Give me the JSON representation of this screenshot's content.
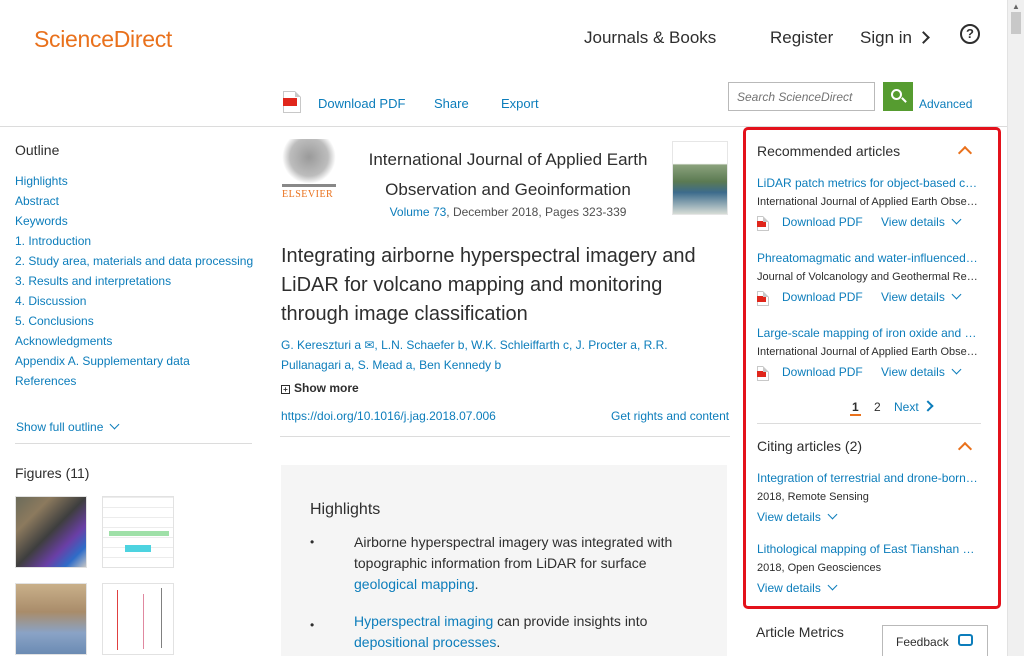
{
  "header": {
    "logo": "ScienceDirect",
    "nav": {
      "journals_books": "Journals & Books",
      "register": "Register",
      "sign_in": "Sign in",
      "help": "?"
    }
  },
  "toolbar": {
    "download_pdf": "Download PDF",
    "share": "Share",
    "export": "Export",
    "search_placeholder": "Search ScienceDirect",
    "advanced": "Advanced"
  },
  "outline": {
    "title": "Outline",
    "items": [
      "Highlights",
      "Abstract",
      "Keywords",
      "1. Introduction",
      "2. Study area, materials and data processing",
      "3. Results and interpretations",
      "4. Discussion",
      "5. Conclusions",
      "Acknowledgments",
      "Appendix A. Supplementary data",
      "References"
    ],
    "show_full": "Show full outline"
  },
  "figures": {
    "title": "Figures (11)"
  },
  "article": {
    "publisher": "ELSEVIER",
    "journal_line1": "International Journal of Applied Earth",
    "journal_line2": "Observation and Geoinformation",
    "volume_link": "Volume 73",
    "volume_rest": ", December 2018, Pages 323-339",
    "title": "Integrating airborne hyperspectral imagery and LiDAR for volcano mapping and monitoring through image classification",
    "authors_line1": "G. Kereszturi a ✉, L.N. Schaefer b, W.K. Schleiffarth c, J. Procter a, R.R.",
    "authors_line2": "Pullanagari a, S. Mead a, Ben Kennedy b",
    "show_more": "Show more",
    "doi": "https://doi.org/10.1016/j.jag.2018.07.006",
    "rights": "Get rights and content"
  },
  "highlights": {
    "title": "Highlights",
    "item1_text": "Airborne hyperspectral imagery was integrated with topographic information from LiDAR for surface",
    "item1_link": "geological mapping",
    "item1_end": ".",
    "item2_link1": "Hyperspectral imaging",
    "item2_mid": " can provide insights into",
    "item2_link2": "depositional processes",
    "item2_end": "."
  },
  "recommended": {
    "title": "Recommended articles",
    "articles": [
      {
        "title": "LiDAR patch metrics for object-based clustering of forest types",
        "journal": "International Journal of Applied Earth Observation and Geoinformation"
      },
      {
        "title": "Phreatomagmatic and water-influenced Strombolian eruptions",
        "journal": "Journal of Volcanology and Geothermal Research"
      },
      {
        "title": "Large-scale mapping of iron oxide and hydroxide minerals",
        "journal": "International Journal of Applied Earth Observation and Geoinformation"
      }
    ],
    "download_pdf": "Download PDF",
    "view_details": "View details",
    "pager": {
      "page1": "1",
      "page2": "2",
      "next": "Next"
    }
  },
  "citing": {
    "title": "Citing articles (2)",
    "articles": [
      {
        "title": "Integration of terrestrial and drone-borne hyperspectral data",
        "meta": "2018, Remote Sensing"
      },
      {
        "title": "Lithological mapping of East Tianshan area",
        "meta": "2018, Open Geosciences"
      }
    ],
    "view_details": "View details"
  },
  "metrics": {
    "title": "Article Metrics"
  },
  "feedback": {
    "label": "Feedback"
  },
  "colors": {
    "brand": "#e9711c",
    "link": "#0c7dbb",
    "highlight_border": "#e3111b",
    "search_button": "#569c30"
  }
}
